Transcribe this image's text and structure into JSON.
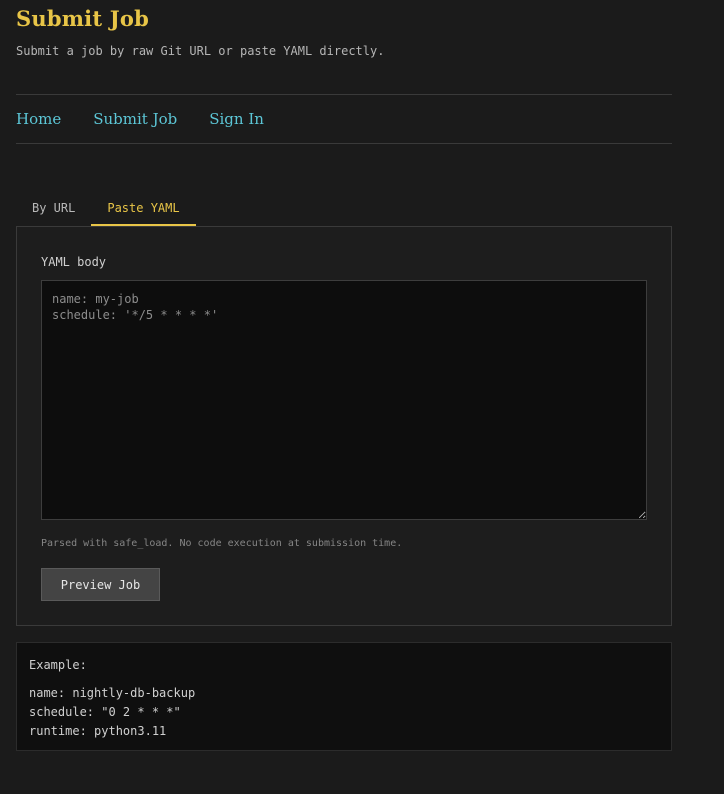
{
  "header": {
    "title": "Submit Job",
    "subtitle": "Submit a job by raw Git URL or paste YAML directly."
  },
  "nav": {
    "items": [
      "Home",
      "Submit Job",
      "Sign In"
    ]
  },
  "tabs": [
    {
      "label": "By URL",
      "active": false
    },
    {
      "label": "Paste YAML",
      "active": true
    }
  ],
  "form": {
    "yaml_label": "YAML body",
    "yaml_placeholder": "name: my-job\nschedule: '*/5 * * * *'",
    "hint": "Parsed with safe_load. No code execution at submission time.",
    "preview_button": "Preview Job"
  },
  "example": {
    "label": "Example:",
    "lines": [
      "name: nightly-db-backup",
      "schedule: \"0 2 * * *\"",
      "runtime: python3.11"
    ]
  },
  "colors": {
    "background": "#1b1b1b",
    "accent": "#e8c547",
    "link": "#5cc6d6"
  }
}
